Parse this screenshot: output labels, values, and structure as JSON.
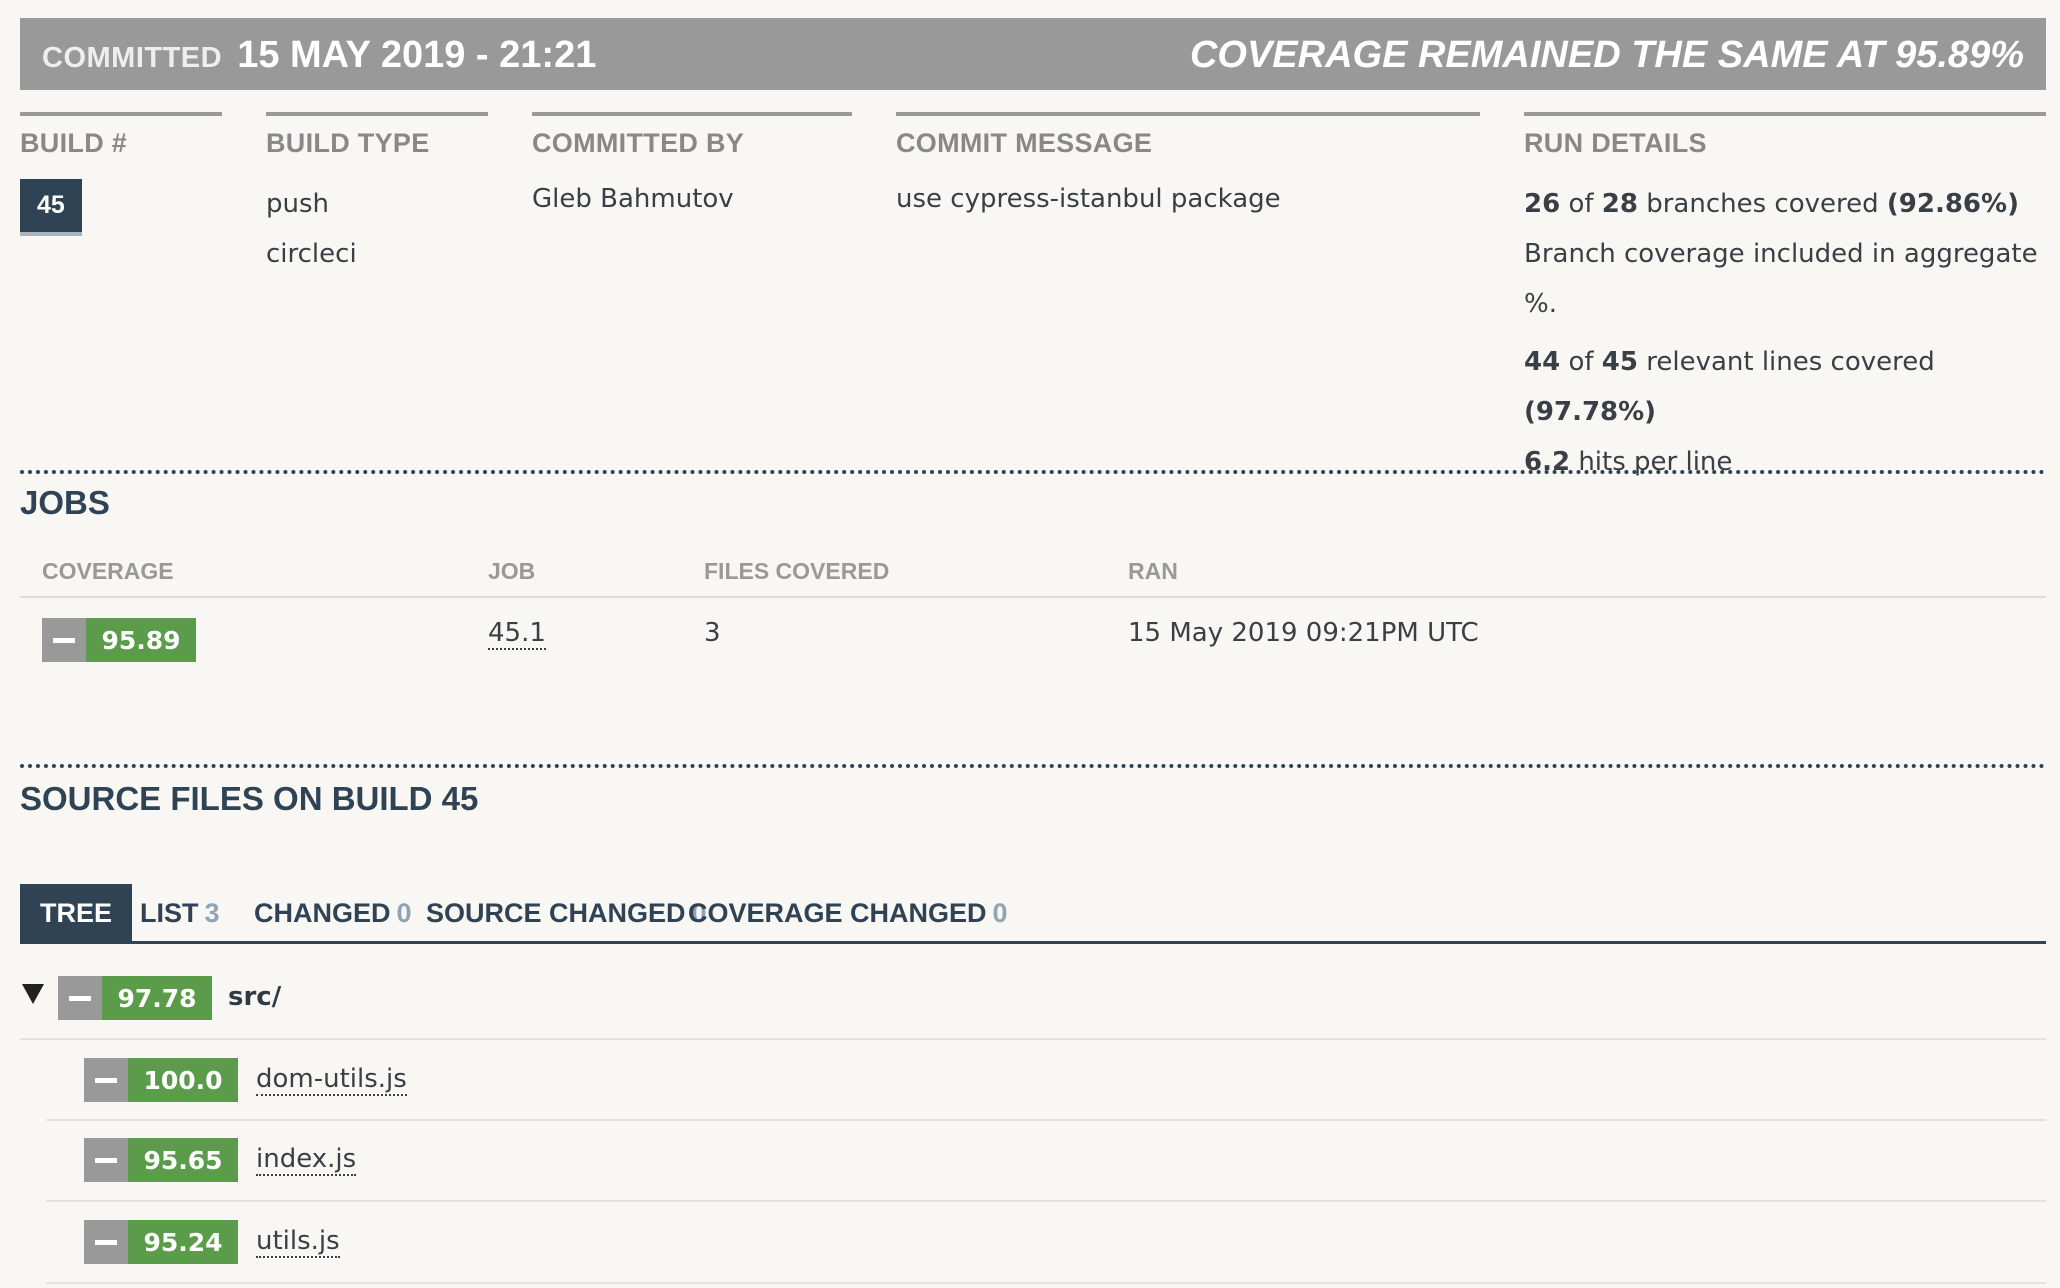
{
  "header": {
    "committed_label": "COMMITTED",
    "committed_date": "15 MAY 2019 - 21:21",
    "coverage_status": "COVERAGE REMAINED THE SAME AT 95.89%"
  },
  "details": {
    "build_label": "BUILD #",
    "build_number": "45",
    "build_type_label": "BUILD TYPE",
    "build_type_values": [
      "push",
      "circleci"
    ],
    "committed_by_label": "COMMITTED BY",
    "committed_by": "Gleb Bahmutov",
    "commit_message_label": "COMMIT MESSAGE",
    "commit_message": "use cypress-istanbul package",
    "run_details_label": "RUN DETAILS",
    "run": {
      "branches_covered": "26",
      "of1": "of",
      "branches_total": "28",
      "branches_text": "branches covered",
      "branches_pct": "(92.86%)",
      "branch_note": "Branch coverage included in aggregate %.",
      "lines_covered": "44",
      "of2": "of",
      "lines_total": "45",
      "lines_text": "relevant lines covered",
      "lines_pct": "(97.78%)",
      "hits": "6.2",
      "hits_text": "hits per line"
    }
  },
  "jobs": {
    "title": "JOBS",
    "columns": [
      "COVERAGE",
      "JOB",
      "FILES COVERED",
      "RAN"
    ],
    "rows": [
      {
        "coverage": "95.89",
        "job": "45.1",
        "files_covered": "3",
        "ran": "15 May 2019 09:21PM UTC"
      }
    ]
  },
  "source_files": {
    "title": "SOURCE FILES ON BUILD 45",
    "tabs": [
      {
        "label": "TREE",
        "count": ""
      },
      {
        "label": "LIST",
        "count": "3"
      },
      {
        "label": "CHANGED",
        "count": "0"
      },
      {
        "label": "SOURCE CHANGED",
        "count": "0"
      },
      {
        "label": "COVERAGE CHANGED",
        "count": "0"
      }
    ],
    "tree": [
      {
        "name": "src/",
        "coverage": "97.78"
      },
      {
        "name": "dom-utils.js",
        "coverage": "100.0"
      },
      {
        "name": "index.js",
        "coverage": "95.65"
      },
      {
        "name": "utils.js",
        "coverage": "95.24"
      }
    ]
  },
  "colors": {
    "header_gray": "#999999",
    "navy": "#2f4354",
    "coverage_green": "#5a9c4a"
  }
}
